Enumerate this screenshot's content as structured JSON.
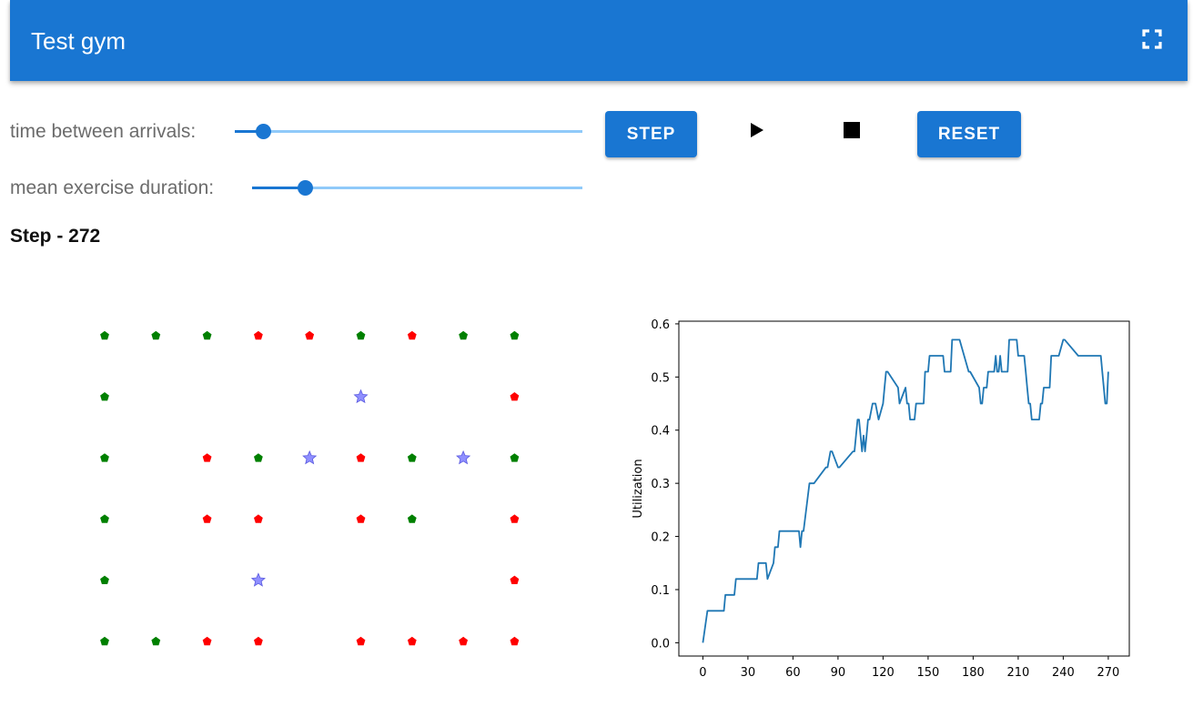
{
  "app": {
    "title": "Test gym",
    "fullscreen_icon": "fullscreen-icon"
  },
  "controls": {
    "arrival": {
      "label": "time between arrivals:",
      "value_fraction": 0.08
    },
    "duration": {
      "label": "mean exercise duration:",
      "value_fraction": 0.16
    },
    "step_label": "STEP",
    "play_icon": "play-icon",
    "stop_icon": "stop-icon",
    "reset_label": "RESET"
  },
  "status": {
    "step_text": "Step - 272"
  },
  "colors": {
    "brand": "#1976d2",
    "free": "#008000",
    "busy": "#ff0000",
    "agent": "#7b7bff",
    "line": "#1f77b4"
  },
  "grid": {
    "cols": 9,
    "rows": 6,
    "cells": [
      [
        "g",
        "g",
        "g",
        "r",
        "r",
        "g",
        "r",
        "g",
        "g"
      ],
      [
        "g",
        "",
        "",
        "",
        "",
        "s",
        "",
        "",
        "r"
      ],
      [
        "g",
        "",
        "r",
        "g",
        "s",
        "r",
        "g",
        "s",
        "g"
      ],
      [
        "g",
        "",
        "r",
        "r",
        "",
        "r",
        "g",
        "",
        "r"
      ],
      [
        "g",
        "",
        "",
        "s",
        "",
        "",
        "",
        "",
        "r"
      ],
      [
        "g",
        "g",
        "r",
        "r",
        "",
        "r",
        "r",
        "r",
        "r"
      ]
    ]
  },
  "chart_data": {
    "type": "line",
    "title": "",
    "xlabel": "",
    "ylabel": "Utilization",
    "xlim": [
      -16,
      284
    ],
    "ylim": [
      -0.025,
      0.605
    ],
    "xticks": [
      0,
      30,
      60,
      90,
      120,
      150,
      180,
      210,
      240,
      270
    ],
    "yticks": [
      0.0,
      0.1,
      0.2,
      0.3,
      0.4,
      0.5,
      0.6
    ],
    "grid": false,
    "series": [
      {
        "x": [
          0,
          3,
          4,
          14,
          15,
          21,
          22,
          36,
          37,
          42,
          43,
          47,
          48,
          50,
          51,
          53,
          54,
          64,
          65,
          66,
          67,
          71,
          72,
          73,
          74,
          82,
          83,
          85,
          86,
          90,
          91,
          100,
          101,
          103,
          104,
          106,
          107,
          108,
          109,
          110,
          111,
          113,
          114,
          115,
          117,
          120,
          121,
          122,
          123,
          130,
          131,
          135,
          136,
          137,
          138,
          141,
          142,
          147,
          148,
          150,
          151,
          153,
          154,
          160,
          161,
          165,
          166,
          170,
          171,
          177,
          178,
          184,
          185,
          186,
          187,
          189,
          190,
          194,
          195,
          196,
          197,
          198,
          199,
          203,
          204,
          209,
          210,
          214,
          215,
          216,
          217,
          218,
          219,
          224,
          225,
          226,
          227,
          231,
          232,
          236,
          237,
          240,
          241,
          250,
          251,
          265,
          266,
          268,
          269,
          270
        ],
        "y": [
          0.0,
          0.06,
          0.06,
          0.06,
          0.09,
          0.09,
          0.12,
          0.12,
          0.15,
          0.15,
          0.12,
          0.15,
          0.18,
          0.18,
          0.21,
          0.21,
          0.21,
          0.21,
          0.18,
          0.21,
          0.21,
          0.3,
          0.3,
          0.3,
          0.3,
          0.33,
          0.33,
          0.36,
          0.36,
          0.33,
          0.33,
          0.36,
          0.36,
          0.42,
          0.42,
          0.36,
          0.39,
          0.36,
          0.39,
          0.42,
          0.42,
          0.45,
          0.45,
          0.45,
          0.42,
          0.45,
          0.48,
          0.51,
          0.51,
          0.48,
          0.45,
          0.48,
          0.45,
          0.45,
          0.42,
          0.42,
          0.45,
          0.45,
          0.51,
          0.51,
          0.54,
          0.54,
          0.54,
          0.54,
          0.51,
          0.51,
          0.57,
          0.57,
          0.57,
          0.51,
          0.51,
          0.48,
          0.45,
          0.45,
          0.48,
          0.48,
          0.51,
          0.51,
          0.54,
          0.51,
          0.51,
          0.54,
          0.51,
          0.51,
          0.57,
          0.57,
          0.54,
          0.54,
          0.51,
          0.48,
          0.45,
          0.45,
          0.42,
          0.42,
          0.45,
          0.45,
          0.48,
          0.48,
          0.54,
          0.54,
          0.54,
          0.57,
          0.57,
          0.54,
          0.54,
          0.54,
          0.51,
          0.45,
          0.45,
          0.51
        ]
      }
    ]
  }
}
